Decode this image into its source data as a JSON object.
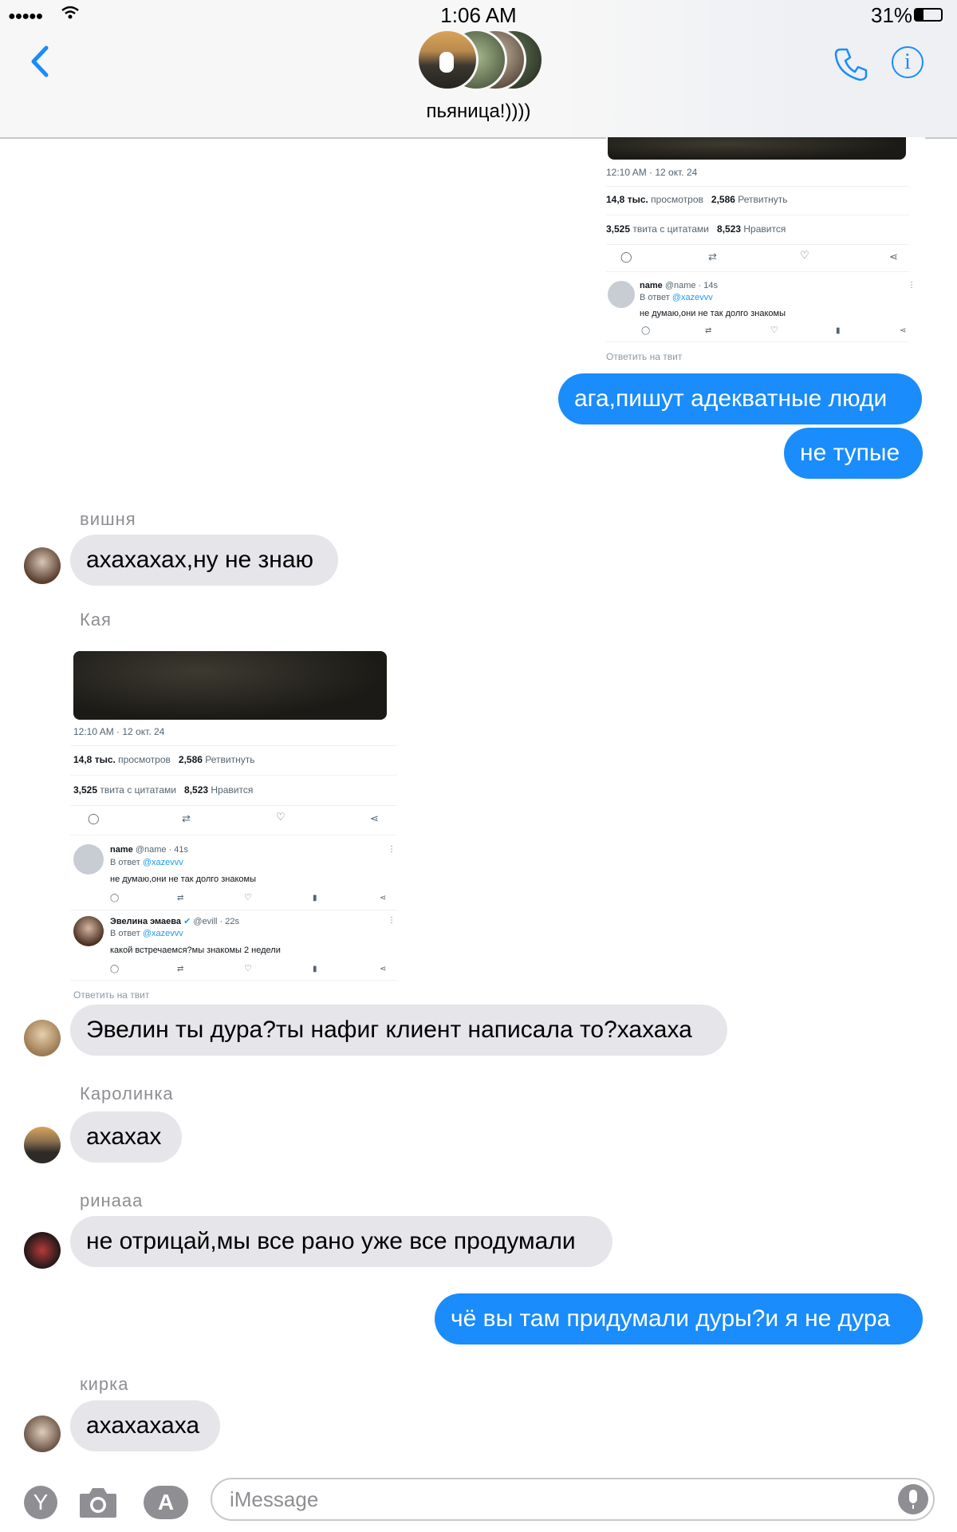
{
  "status_bar": {
    "time": "1:06 AM",
    "battery": "31%"
  },
  "header": {
    "group_name": "пьяница!))))"
  },
  "tweet_top": {
    "date": "12:10 AM · 12 окт. 24",
    "views_num": "14,8 тыс.",
    "views_label": "просмотров",
    "retweets_num": "2,586",
    "retweets_label": "Ретвитнуть",
    "quotes_num": "3,525",
    "quotes_label": "твита с цитатами",
    "likes_num": "8,523",
    "likes_label": "Нравится",
    "reply1_name": "name",
    "reply1_handle": "@name · 14s",
    "reply1_to": "В ответ",
    "reply1_to_handle": "@xazevvv",
    "reply1_text": "не думаю,они не так долго знакомы",
    "reply_prompt": "Ответить на твит"
  },
  "tweet_mid": {
    "date": "12:10 AM · 12 окт. 24",
    "views_num": "14,8 тыс.",
    "views_label": "просмотров",
    "retweets_num": "2,586",
    "retweets_label": "Ретвитнуть",
    "quotes_num": "3,525",
    "quotes_label": "твита с цитатами",
    "likes_num": "8,523",
    "likes_label": "Нравится",
    "reply1_name": "name",
    "reply1_handle": "@name · 41s",
    "reply1_to": "В ответ",
    "reply1_to_handle": "@xazevvv",
    "reply1_text": "не думаю,они не так долго знакомы",
    "reply2_name": "Эвелина эмаева",
    "reply2_handle": "@evill · 22s",
    "reply2_to": "В ответ",
    "reply2_to_handle": "@xazevvv",
    "reply2_text": "какой встречаемся?мы знакомы 2 недели",
    "reply_prompt": "Ответить на твит"
  },
  "messages": {
    "m1": "ага,пишут адекватные люди",
    "m2": "не тупые",
    "s1": "вишня",
    "m3": "ахахахах,ну не знаю",
    "s2": "Кая",
    "m4": "Эвелин ты дура?ты нафиг клиент написала то?хахаха",
    "s3": "Каролинка",
    "m5": "ахахах",
    "s4": "ринааа",
    "m6": "не отрицай,мы все рано уже все продумали",
    "m7": "чё вы там придумали дуры?и я не дура",
    "s5": "кирка",
    "m8": "ахахахаха"
  },
  "input": {
    "placeholder": "iMessage"
  },
  "icons": {
    "back": "chevron-left-icon",
    "phone": "phone-icon",
    "info": "info-icon",
    "camera": "camera-icon",
    "apps": "app-store-icon",
    "mic": "microphone-icon"
  },
  "colors": {
    "outgoing": "#1a8cfb",
    "incoming": "#e5e5ea",
    "accent": "#1a8cfb"
  }
}
